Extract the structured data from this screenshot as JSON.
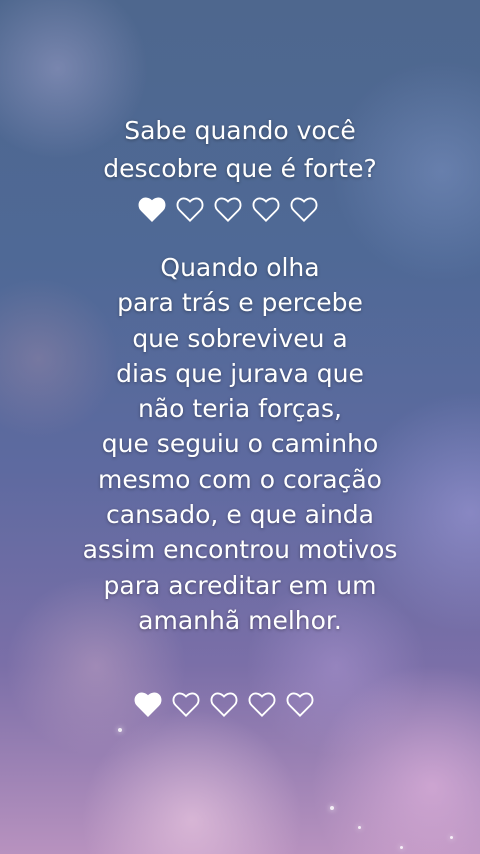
{
  "headline": {
    "lines": [
      "Sabe quando você",
      "descobre que é forte?"
    ]
  },
  "hearts_top": {
    "total": 5,
    "filled": 1,
    "icon": "heart-icon"
  },
  "body": {
    "lines": [
      "Quando olha",
      "para trás e percebe",
      "que sobreviveu a",
      "dias que jurava que",
      "não teria forças,",
      "que seguiu o caminho",
      "mesmo com o coração",
      "cansado, e que ainda",
      "assim encontrou motivos",
      "para acreditar em um",
      "amanhã melhor."
    ]
  },
  "hearts_bottom": {
    "total": 5,
    "filled": 1,
    "icon": "heart-icon"
  },
  "colors": {
    "text": "#ffffff",
    "background_top": "#4e678e",
    "background_bottom": "#b892bf"
  }
}
